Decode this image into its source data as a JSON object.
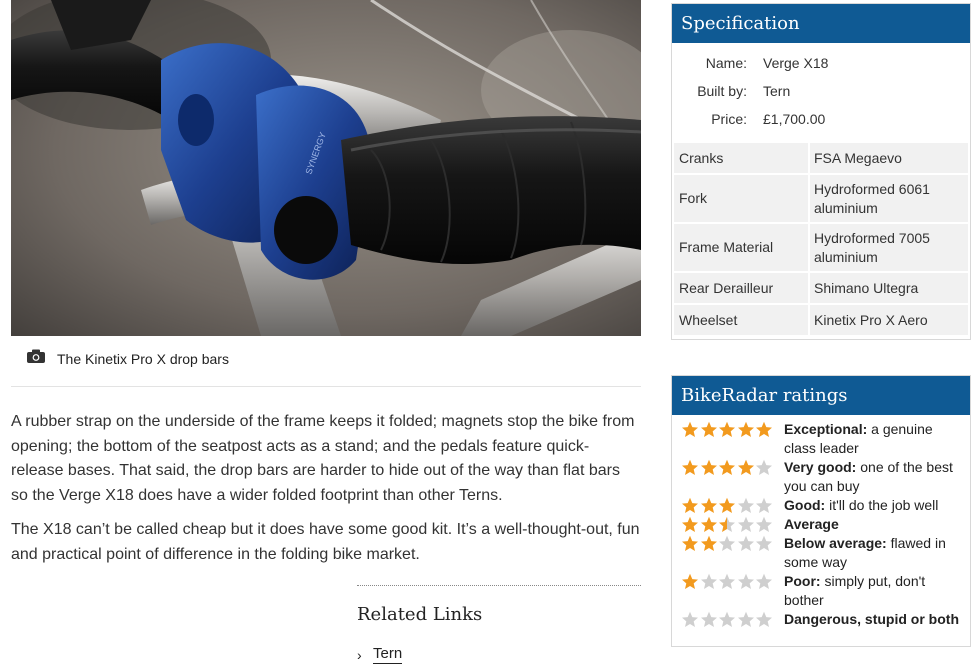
{
  "article": {
    "caption": "The Kinetix Pro X drop bars",
    "paragraphs": [
      "A rubber strap on the underside of the frame keeps it folded; magnets stop the bike from opening; the bottom of the seatpost acts as a stand; and the pedals feature quick-release bases. That said, the drop bars are harder to hide out of the way than flat bars so the Verge X18 does have a wider folded footprint than other Terns.",
      "The X18 can’t be called cheap but it does have some good kit. It’s a well-thought-out, fun and practical point of difference in the folding bike market."
    ],
    "photo_brand_text": "SYNERGY"
  },
  "related": {
    "title": "Related Links",
    "links": [
      "Tern"
    ]
  },
  "spec": {
    "title": "Specification",
    "summary": [
      {
        "key": "Name:",
        "value": "Verge X18"
      },
      {
        "key": "Built by:",
        "value": "Tern"
      },
      {
        "key": "Price:",
        "value": "£1,700.00"
      }
    ],
    "rows": [
      {
        "key": "Cranks",
        "value": "FSA Megaevo"
      },
      {
        "key": "Fork",
        "value": "Hydroformed 6061 aluminium"
      },
      {
        "key": "Frame Material",
        "value": "Hydroformed 7005 aluminium"
      },
      {
        "key": "Rear Derailleur",
        "value": "Shimano Ultegra"
      },
      {
        "key": "Wheelset",
        "value": "Kinetix Pro X Aero"
      }
    ]
  },
  "ratings": {
    "title": "BikeRadar ratings",
    "items": [
      {
        "stars": 5,
        "label": "Exceptional:",
        "desc": " a genuine class leader"
      },
      {
        "stars": 4,
        "label": "Very good:",
        "desc": " one of the best you can buy"
      },
      {
        "stars": 3,
        "label": "Good:",
        "desc": " it'll do the job well"
      },
      {
        "stars": 2.5,
        "label": "Average",
        "desc": ""
      },
      {
        "stars": 2,
        "label": "Below average:",
        "desc": " flawed in some way"
      },
      {
        "stars": 1,
        "label": "Poor:",
        "desc": " simply put, don't bother"
      },
      {
        "stars": 0,
        "label": "Dangerous, stupid or both",
        "desc": ""
      }
    ]
  },
  "colors": {
    "brand_blue": "#0f5a94",
    "star_gold": "#f29a1e",
    "star_grey": "#cfcfcf"
  }
}
